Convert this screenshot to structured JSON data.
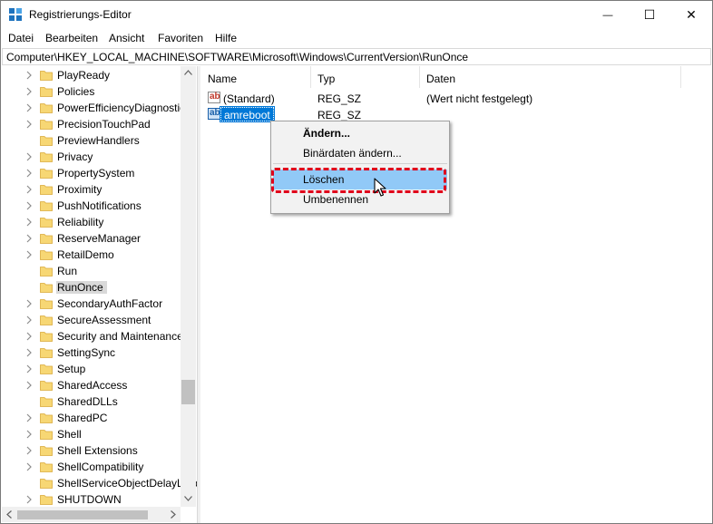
{
  "window": {
    "title": "Registrierungs-Editor",
    "minimize_glyph": "—",
    "maximize_glyph": "☐",
    "close_glyph": "✕"
  },
  "menu": [
    "Datei",
    "Bearbeiten",
    "Ansicht",
    "Favoriten",
    "Hilfe"
  ],
  "address": "Computer\\HKEY_LOCAL_MACHINE\\SOFTWARE\\Microsoft\\Windows\\CurrentVersion\\RunOnce",
  "tree": {
    "items": [
      {
        "label": "PlayReady",
        "expandable": true
      },
      {
        "label": "Policies",
        "expandable": true
      },
      {
        "label": "PowerEfficiencyDiagnostic",
        "expandable": true
      },
      {
        "label": "PrecisionTouchPad",
        "expandable": true
      },
      {
        "label": "PreviewHandlers",
        "expandable": false
      },
      {
        "label": "Privacy",
        "expandable": true
      },
      {
        "label": "PropertySystem",
        "expandable": true
      },
      {
        "label": "Proximity",
        "expandable": true
      },
      {
        "label": "PushNotifications",
        "expandable": true
      },
      {
        "label": "Reliability",
        "expandable": true
      },
      {
        "label": "ReserveManager",
        "expandable": true
      },
      {
        "label": "RetailDemo",
        "expandable": true
      },
      {
        "label": "Run",
        "expandable": false
      },
      {
        "label": "RunOnce",
        "expandable": false,
        "selected": true
      },
      {
        "label": "SecondaryAuthFactor",
        "expandable": true
      },
      {
        "label": "SecureAssessment",
        "expandable": true
      },
      {
        "label": "Security and Maintenance",
        "expandable": true
      },
      {
        "label": "SettingSync",
        "expandable": true
      },
      {
        "label": "Setup",
        "expandable": true
      },
      {
        "label": "SharedAccess",
        "expandable": true
      },
      {
        "label": "SharedDLLs",
        "expandable": false
      },
      {
        "label": "SharedPC",
        "expandable": true
      },
      {
        "label": "Shell",
        "expandable": true
      },
      {
        "label": "Shell Extensions",
        "expandable": true
      },
      {
        "label": "ShellCompatibility",
        "expandable": true
      },
      {
        "label": "ShellServiceObjectDelayLoad",
        "expandable": false
      },
      {
        "label": "SHUTDOWN",
        "expandable": true
      }
    ]
  },
  "list": {
    "columns": [
      "Name",
      "Typ",
      "Daten"
    ],
    "rows": [
      {
        "icon": "ab",
        "name": "(Standard)",
        "type": "REG_SZ",
        "data": "(Wert nicht festgelegt)"
      },
      {
        "icon": "ab",
        "name": "amreboot",
        "type": "REG_SZ",
        "data": "",
        "selected": true
      }
    ]
  },
  "context_menu": {
    "items": [
      "Ändern...",
      "Binärdaten ändern...",
      "Löschen",
      "Umbenennen"
    ],
    "highlighted": "Löschen"
  },
  "colors": {
    "selection": "#0078d7",
    "menu_highlight": "#91c9f7",
    "annotation": "#e0001b",
    "folder": "#f7d774"
  }
}
